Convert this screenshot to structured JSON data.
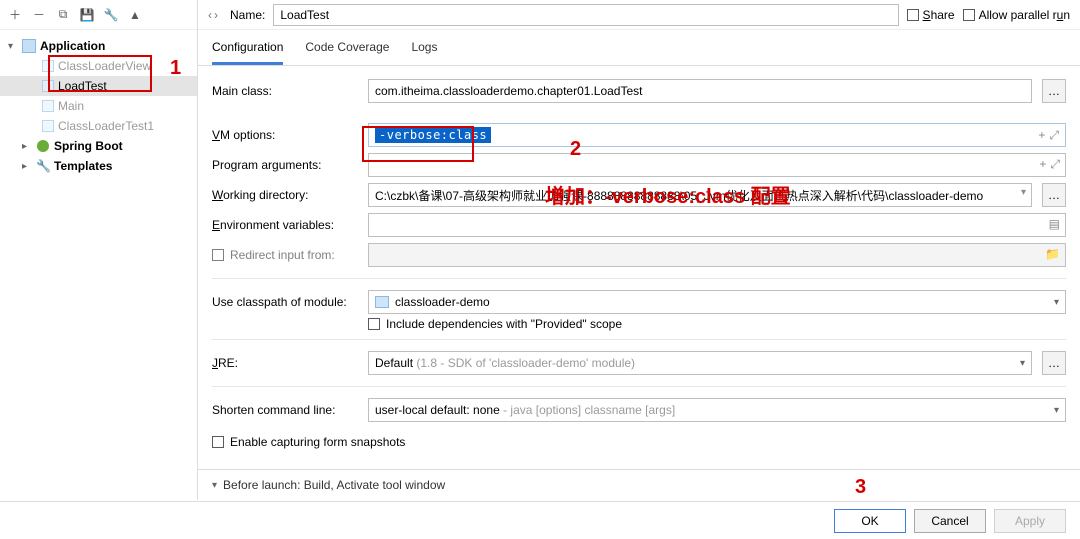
{
  "sidebar": {
    "items": [
      {
        "label": "Application",
        "bold": true,
        "expanded": true
      },
      {
        "label": "ClassLoaderView"
      },
      {
        "label": "LoadTest",
        "selected": true
      },
      {
        "label": "Main"
      },
      {
        "label": "ClassLoaderTest1"
      },
      {
        "label": "Spring Boot",
        "bold": true,
        "expanded": false
      },
      {
        "label": "Templates",
        "bold": true,
        "expanded": false
      }
    ]
  },
  "header": {
    "name_label": "Name:",
    "name_value": "LoadTest",
    "share_label": "Share",
    "parallel_label": "Allow parallel run"
  },
  "tabs": [
    {
      "label": "Configuration",
      "active": true
    },
    {
      "label": "Code Coverage"
    },
    {
      "label": "Logs"
    }
  ],
  "form": {
    "main_class_label": "Main class:",
    "main_class_value": "com.itheima.classloaderdemo.chapter01.LoadTest",
    "vm_options_label": "VM options:",
    "vm_options_value": "-verbose:class",
    "program_args_label": "Program arguments:",
    "working_dir_label": "Working directory:",
    "working_dir_value": "C:\\czbk\\备课\\07-高级架构师就业加强课-88888888888888\\05_Jvm优化及面试热点深入解析\\代码\\classloader-demo",
    "env_label": "Environment variables:",
    "redirect_label": "Redirect input from:",
    "classpath_label": "Use classpath of module:",
    "classpath_value": "classloader-demo",
    "include_provided_label": "Include dependencies with \"Provided\" scope",
    "jre_label": "JRE:",
    "jre_value": "Default",
    "jre_hint": " (1.8 - SDK of 'classloader-demo' module)",
    "shorten_label": "Shorten command line:",
    "shorten_value": "user-local default: none",
    "shorten_hint": " - java [options] classname [args]",
    "snapshot_label": "Enable capturing form snapshots"
  },
  "before_launch": {
    "label": "Before launch: Build, Activate tool window"
  },
  "buttons": {
    "ok": "OK",
    "cancel": "Cancel",
    "apply": "Apply"
  },
  "annotations": {
    "one": "1",
    "two": "2",
    "three": "3",
    "text": "增加：-verbose:class 配置"
  }
}
